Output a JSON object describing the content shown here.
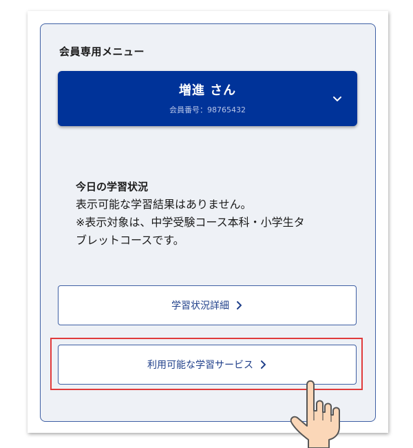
{
  "menu": {
    "title": "会員専用メニュー"
  },
  "member": {
    "name": "増進 さん",
    "number_label": "会員番号：98765432",
    "expand_icon": "chevron-down-icon"
  },
  "study_status": {
    "heading": "今日の学習状況",
    "message": "表示可能な学習結果はありません。",
    "note_line1": "※表示対象は、中学受験コース本科・小学生タ",
    "note_line2": "ブレットコースです。"
  },
  "buttons": {
    "detail_label": "学習状況詳細",
    "service_label": "利用可能な学習サービス"
  },
  "colors": {
    "card": "#003399",
    "panel": "#eef1f6",
    "border": "#3d5ea3",
    "highlight": "#e03a3a"
  }
}
